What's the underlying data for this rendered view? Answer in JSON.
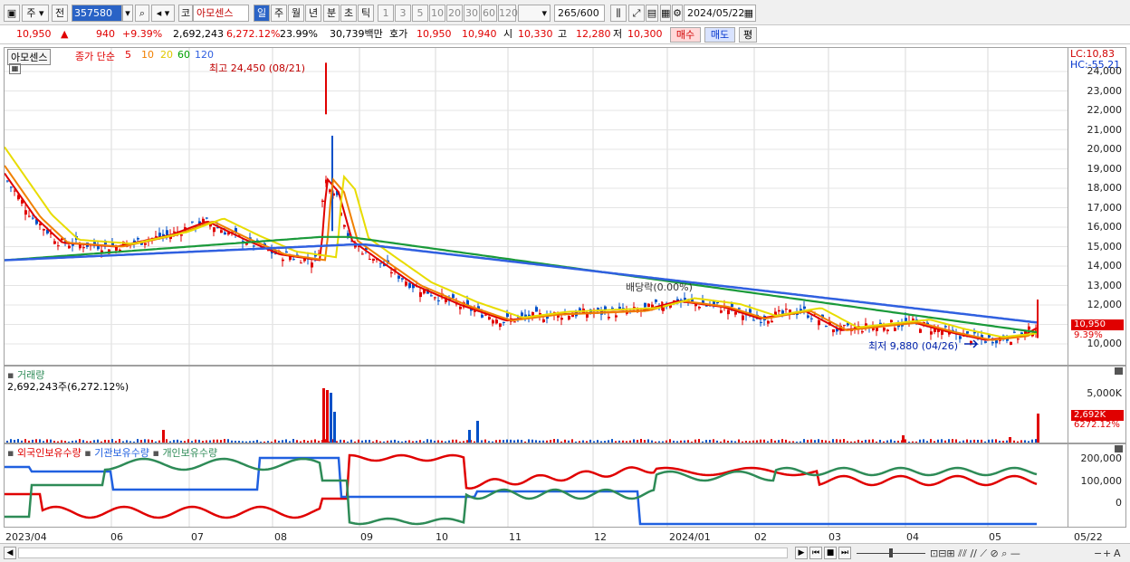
{
  "toolbar": {
    "market_label": "주",
    "prev_label": "전",
    "code_value": "357580",
    "code_label": "코",
    "stock_name": "아모센스",
    "period_tabs": [
      "일",
      "주",
      "월",
      "년",
      "분",
      "초",
      "틱"
    ],
    "active_period": "일",
    "interval_tabs": [
      "1",
      "3",
      "5",
      "10",
      "20",
      "30",
      "60",
      "120"
    ],
    "bar_count": "265",
    "bar_total": "/600",
    "date_value": "2024/05/22"
  },
  "quote": {
    "price": "10,950",
    "change_arrow": "▲",
    "change": "940",
    "change_rate": "+9.39%",
    "volume": "2,692,243",
    "volume_ratio": "6,272.12%",
    "turnover": "23.99%",
    "amount": "30,739백만",
    "bid_label": "호가",
    "ask_price": "10,950",
    "bid_price": "10,940",
    "open_label": "시",
    "open": "10,330",
    "high_label": "고",
    "high": "12,280",
    "low_label": "저",
    "low": "10,300",
    "buy_button": "매수",
    "sell_button": "매도",
    "eval_button": "평"
  },
  "price_pane": {
    "name_chip": "아모센스",
    "indicator_label": "종가 단순",
    "ma_periods": [
      "5",
      "10",
      "20",
      "60",
      "120"
    ],
    "ma_colors": [
      "#e00000",
      "#f08000",
      "#e0d000",
      "#00a000",
      "#3060e0"
    ],
    "lc_label": "LC:10,83",
    "hc_label": "HC:-55.21",
    "high_annotation": "최고 24,450 (08/21)",
    "low_annotation": "최저 9,880 (04/26)",
    "dividend_annotation": "배당락(0.00%)",
    "price_badge": "10,950",
    "rate_badge": "9.39%",
    "y_ticks": [
      "24,000",
      "23,000",
      "22,000",
      "21,000",
      "20,000",
      "19,000",
      "18,000",
      "17,000",
      "16,000",
      "15,000",
      "14,000",
      "13,000",
      "12,000",
      "11,000",
      "10,000"
    ]
  },
  "volume_pane": {
    "title": "거래량",
    "value_label": "2,692,243주(6,272.12%)",
    "y_tick": "5,000K",
    "volume_badge": "2,692K",
    "ratio_badge": "6272.12%"
  },
  "holding_pane": {
    "legend": [
      "외국인보유수량",
      "기관보유수량",
      "개인보유수량"
    ],
    "legend_colors": [
      "#e00000",
      "#2060e0",
      "#2e8b57"
    ],
    "y_ticks": [
      "200,000",
      "100,000",
      "0"
    ]
  },
  "x_ticks": [
    "2023/04",
    "06",
    "07",
    "08",
    "09",
    "10",
    "11",
    "12",
    "2024/01",
    "02",
    "03",
    "04",
    "05",
    "05/22"
  ]
}
